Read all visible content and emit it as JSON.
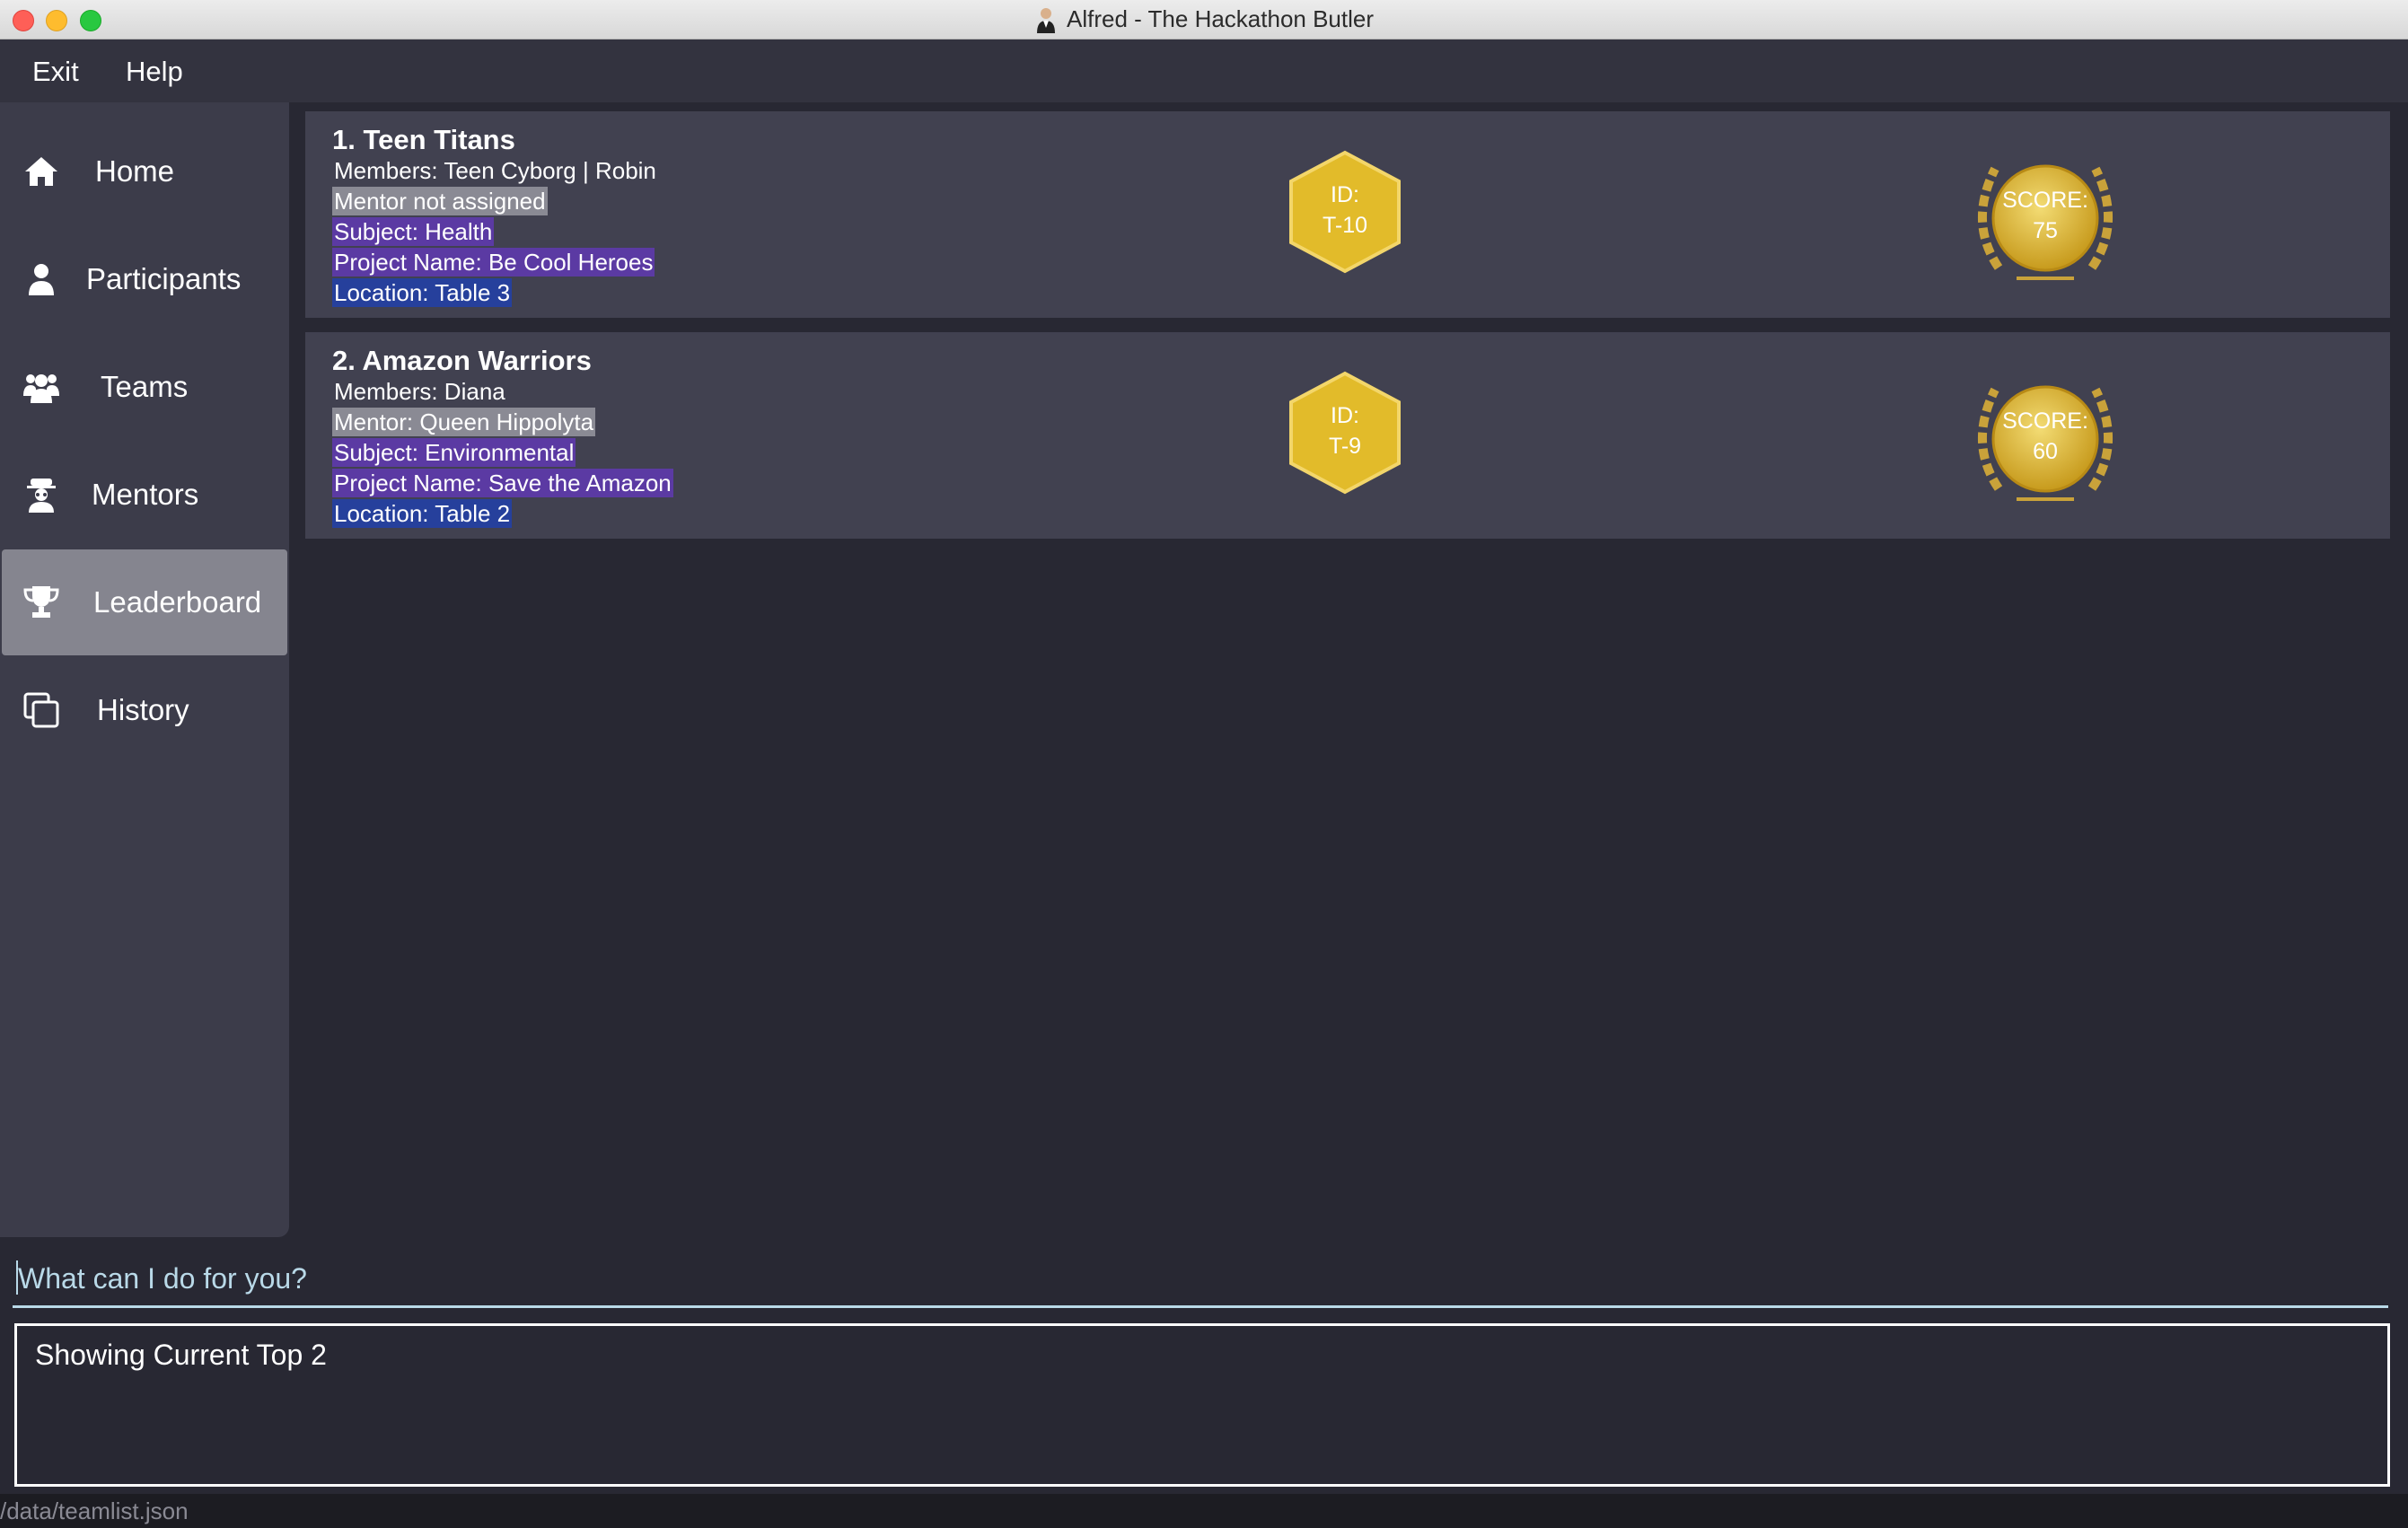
{
  "window": {
    "title": "Alfred - The Hackathon Butler"
  },
  "menu": {
    "exit": "Exit",
    "help": "Help"
  },
  "sidebar": {
    "items": [
      {
        "label": "Home",
        "icon": "home-icon"
      },
      {
        "label": "Participants",
        "icon": "person-icon"
      },
      {
        "label": "Teams",
        "icon": "group-icon"
      },
      {
        "label": "Mentors",
        "icon": "mentor-icon"
      },
      {
        "label": "Leaderboard",
        "icon": "trophy-icon",
        "active": true
      },
      {
        "label": "History",
        "icon": "history-icon"
      }
    ]
  },
  "teams": [
    {
      "rank_name": "1.  Teen Titans",
      "members": "Members:   Teen Cyborg | Robin",
      "mentor": "Mentor not assigned",
      "subject": "Subject: Health",
      "project": "Project Name: Be Cool Heroes",
      "location": "Location:  Table 3",
      "id_label": "ID:",
      "id_value": "T-10",
      "score_label": "SCORE:",
      "score_value": "75"
    },
    {
      "rank_name": "2.  Amazon Warriors",
      "members": "Members:   Diana",
      "mentor": "Mentor: Queen Hippolyta",
      "subject": "Subject: Environmental",
      "project": "Project Name: Save the Amazon",
      "location": "Location:  Table 2",
      "id_label": "ID:",
      "id_value": "T-9",
      "score_label": "SCORE:",
      "score_value": "60"
    }
  ],
  "command": {
    "placeholder": "What can I do for you?"
  },
  "result": {
    "text": "Showing Current Top 2"
  },
  "status": {
    "path": "/data/teamlist.json"
  },
  "colors": {
    "background": "#282833",
    "sidebar": "#3c3c4a",
    "card": "#414150",
    "active_nav": "#85858f",
    "gold": "#e2bb2a",
    "highlight_purple": "#5b3aa3",
    "highlight_blue": "#26409c"
  }
}
